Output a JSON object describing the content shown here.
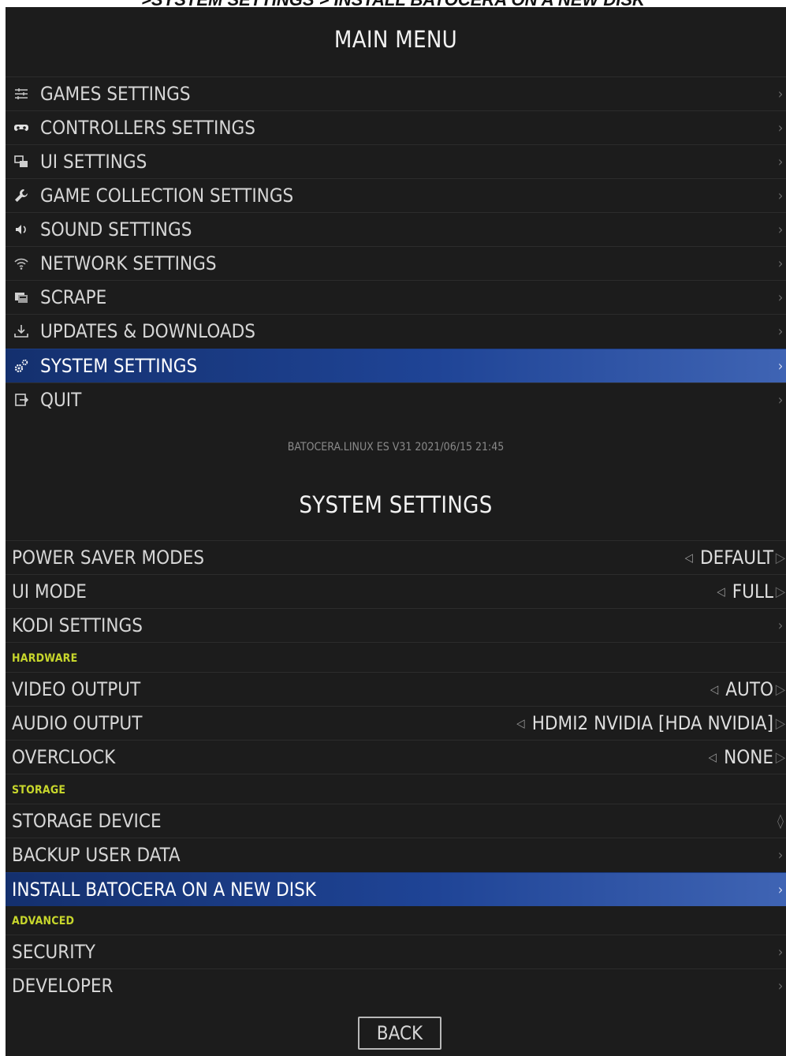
{
  "caption": ">SYSTEM SETTINGS > INSTALL BATOCERA ON A NEW DISK",
  "main_menu": {
    "title": "MAIN MENU",
    "items": [
      {
        "label": "GAMES SETTINGS",
        "icon": "sliders-icon"
      },
      {
        "label": "CONTROLLERS SETTINGS",
        "icon": "gamepad-icon"
      },
      {
        "label": "UI SETTINGS",
        "icon": "ui-windows-icon"
      },
      {
        "label": "GAME COLLECTION SETTINGS",
        "icon": "wrench-icon"
      },
      {
        "label": "SOUND SETTINGS",
        "icon": "speaker-icon"
      },
      {
        "label": "NETWORK SETTINGS",
        "icon": "wifi-icon"
      },
      {
        "label": "SCRAPE",
        "icon": "scrape-icon"
      },
      {
        "label": "UPDATES & DOWNLOADS",
        "icon": "download-icon"
      },
      {
        "label": "SYSTEM SETTINGS",
        "icon": "gears-icon",
        "selected": true
      },
      {
        "label": "QUIT",
        "icon": "exit-icon"
      }
    ],
    "version": "BATOCERA.LINUX ES V31 2021/06/15 21:45"
  },
  "system_settings": {
    "title": "SYSTEM SETTINGS",
    "power_saver": {
      "label": "POWER SAVER MODES",
      "value": "DEFAULT"
    },
    "ui_mode": {
      "label": "UI MODE",
      "value": "FULL"
    },
    "kodi": {
      "label": "KODI SETTINGS"
    },
    "section_hardware": "HARDWARE",
    "video_output": {
      "label": "VIDEO OUTPUT",
      "value": "AUTO"
    },
    "audio_output": {
      "label": "AUDIO OUTPUT",
      "value": "HDMI2 NVIDIA [HDA NVIDIA]"
    },
    "overclock": {
      "label": "OVERCLOCK",
      "value": "NONE"
    },
    "section_storage": "STORAGE",
    "storage_device": {
      "label": "STORAGE DEVICE"
    },
    "backup": {
      "label": "BACKUP USER DATA"
    },
    "install": {
      "label": "INSTALL BATOCERA ON A NEW DISK",
      "selected": true
    },
    "section_advanced": "ADVANCED",
    "security": {
      "label": "SECURITY"
    },
    "developer": {
      "label": "DEVELOPER"
    },
    "back_label": "BACK"
  },
  "colors": {
    "background": "#1c1c1c",
    "selected_start": "#14306e",
    "selected_end": "#3f64b4",
    "section_header": "#c7d62c"
  }
}
